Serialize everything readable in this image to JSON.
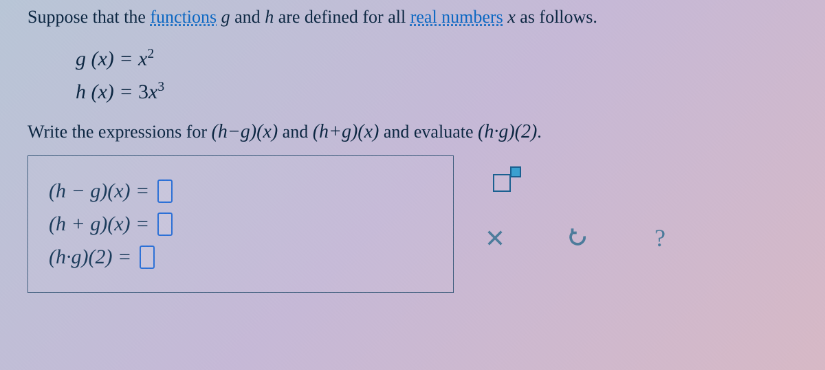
{
  "intro": {
    "t1": "Suppose that the ",
    "link1": "functions",
    "t2": " ",
    "g": "g",
    "t3": " and ",
    "h": "h",
    "t4": " are defined for all ",
    "link2": "real numbers",
    "t5": " ",
    "x": "x",
    "t6": " as follows."
  },
  "defs": {
    "g_lhs": "g (x)",
    "eq": " = ",
    "g_rhs_base": "x",
    "g_rhs_exp": "2",
    "h_lhs": "h (x)",
    "h_rhs_coef": "3",
    "h_rhs_base": "x",
    "h_rhs_exp": "3"
  },
  "task": {
    "t1": "Write the expressions for ",
    "e1": "(h−g)(x)",
    "t2": " and ",
    "e2": "(h+g)(x)",
    "t3": " and evaluate ",
    "e3": "(h·g)(2)",
    "t4": "."
  },
  "answers": {
    "r1_label": "(h − g)(x) = ",
    "r2_label": "(h + g)(x) = ",
    "r3_label": "(h·g)(2) = "
  },
  "tools": {
    "exponent": "exponent-tool",
    "clear": "clear",
    "undo": "undo",
    "help": "?"
  }
}
